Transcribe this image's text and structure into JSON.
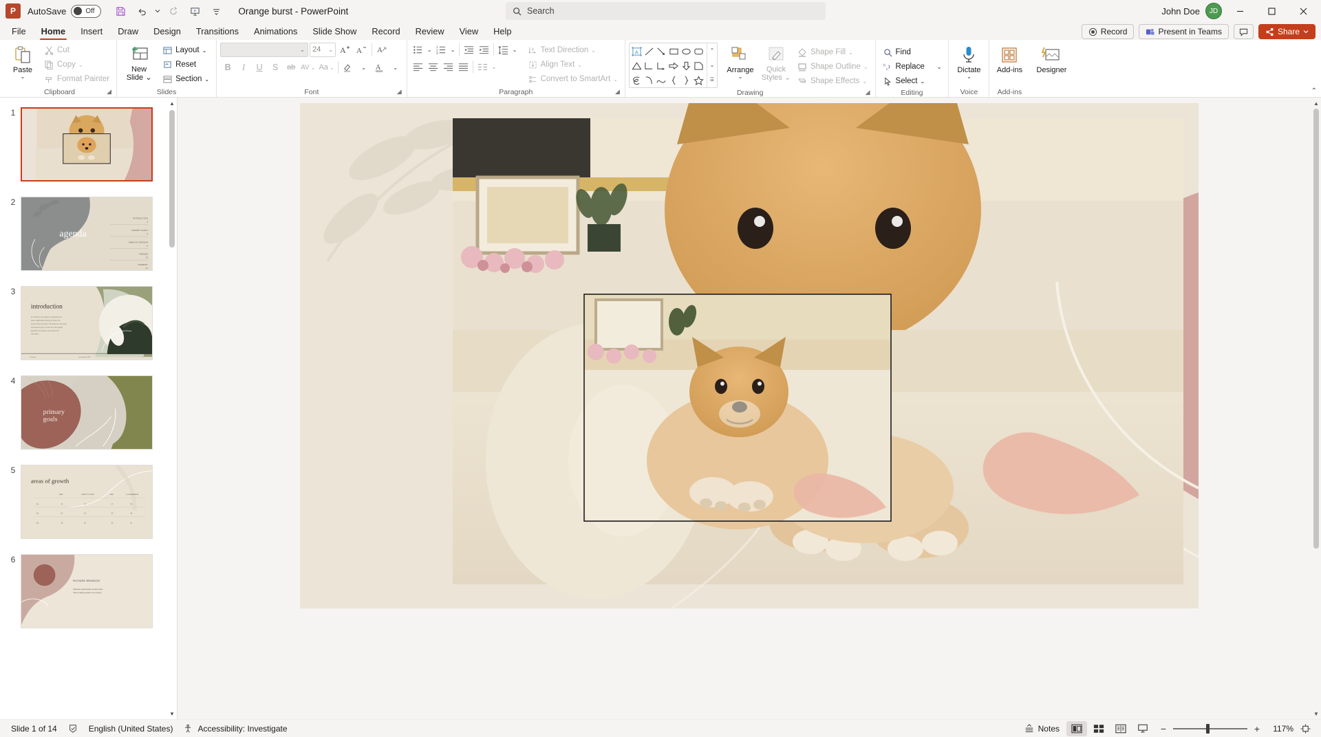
{
  "titlebar": {
    "logo": "P",
    "autosave_label": "AutoSave",
    "autosave_state": "Off",
    "quick_access": [
      {
        "name": "save-button",
        "glyph": "ὋE"
      },
      {
        "name": "undo-button",
        "glyph": "↶"
      },
      {
        "name": "redo-button",
        "glyph": "↻"
      },
      {
        "name": "start-presentation-button",
        "glyph": "⬜"
      },
      {
        "name": "customize-quick-access-button",
        "glyph": "⌵"
      }
    ],
    "document_title": "Orange burst  -  PowerPoint",
    "search_placeholder": "Search",
    "user_name": "John Doe",
    "avatar_initials": "JD",
    "window_buttons": [
      "minimize",
      "maximize",
      "close"
    ]
  },
  "tabs": [
    {
      "label": "File",
      "active": false
    },
    {
      "label": "Home",
      "active": true
    },
    {
      "label": "Insert",
      "active": false
    },
    {
      "label": "Draw",
      "active": false
    },
    {
      "label": "Design",
      "active": false
    },
    {
      "label": "Transitions",
      "active": false
    },
    {
      "label": "Animations",
      "active": false
    },
    {
      "label": "Slide Show",
      "active": false
    },
    {
      "label": "Record",
      "active": false
    },
    {
      "label": "Review",
      "active": false
    },
    {
      "label": "View",
      "active": false
    },
    {
      "label": "Help",
      "active": false
    }
  ],
  "tabs_right": {
    "record_label": "Record",
    "present_in_teams_label": "Present in Teams",
    "comments_label": "",
    "share_label": "Share"
  },
  "ribbon": {
    "clipboard": {
      "group_label": "Clipboard",
      "paste_label": "Paste",
      "cut_label": "Cut",
      "copy_label": "Copy",
      "format_painter_label": "Format Painter"
    },
    "slides": {
      "group_label": "Slides",
      "new_slide_label_line1": "New",
      "new_slide_label_line2": "Slide",
      "layout_label": "Layout",
      "reset_label": "Reset",
      "section_label": "Section"
    },
    "font": {
      "group_label": "Font",
      "font_name_value": "",
      "font_size_value": "24",
      "bold_label": "B",
      "italic_label": "I",
      "underline_label": "U",
      "shadow_label": "S",
      "strikethrough_label": "ab",
      "character_spacing_label": "AV",
      "change_case_label": "Aa",
      "increase_font_label": "A",
      "decrease_font_label": "A",
      "clear_formatting_label": "A"
    },
    "paragraph": {
      "group_label": "Paragraph",
      "text_direction_label": "Text Direction",
      "align_text_label": "Align Text",
      "convert_to_smartart_label": "Convert to SmartArt"
    },
    "drawing": {
      "group_label": "Drawing",
      "arrange_label": "Arrange",
      "quick_styles_line1": "Quick",
      "quick_styles_line2": "Styles",
      "shape_fill_label": "Shape Fill",
      "shape_outline_label": "Shape Outline",
      "shape_effects_label": "Shape Effects"
    },
    "editing": {
      "group_label": "Editing",
      "find_label": "Find",
      "replace_label": "Replace",
      "select_label": "Select"
    },
    "voice": {
      "group_label": "Voice",
      "dictate_label": "Dictate"
    },
    "addins": {
      "group_label": "Add-ins",
      "addins_label": "Add-ins"
    },
    "designer": {
      "designer_label": "Designer"
    }
  },
  "thumbnails": [
    {
      "number": "1",
      "selected": true,
      "kind": "photo-dog",
      "title": ""
    },
    {
      "number": "2",
      "selected": false,
      "kind": "agenda",
      "title": "agenda",
      "items": [
        {
          "label": "INTRODUCTION",
          "page": "3"
        },
        {
          "label": "PRIMARY GOALS",
          "page": "5"
        },
        {
          "label": "AREAS OF GROWTH",
          "page": "8"
        },
        {
          "label": "TIMELINE",
          "page": "10"
        },
        {
          "label": "SUMMARY",
          "page": "14"
        }
      ]
    },
    {
      "number": "3",
      "selected": false,
      "kind": "introduction",
      "title": "introduction",
      "body": "At Z Interiors we empower organizations to foster collaborative thinking to further the overall value proposition. By driving the next-level convergence gap, we have the micro-quality approach and create a memorable first impression."
    },
    {
      "number": "4",
      "selected": false,
      "kind": "primary-goals",
      "title": "primary goals",
      "title_line1": "primary",
      "title_line2": "goals"
    },
    {
      "number": "5",
      "selected": false,
      "kind": "areas-of-growth",
      "title": "areas of growth",
      "columns": [
        "",
        "B2B",
        "SUPPLY CHAIN",
        "R&D",
        "E-COMMERCE"
      ]
    },
    {
      "number": "6",
      "selected": false,
      "kind": "quote",
      "title": "RICHARD BRANDON",
      "quote": "\"Business opportunities are like buses. There's always another one coming.\""
    }
  ],
  "slide": {
    "number": "1",
    "selected_image_name": "doge-shiba-inu-photo",
    "has_selection_handles": true
  },
  "statusbar": {
    "slide_counter": "Slide 1 of 14",
    "language": "English (United States)",
    "accessibility": "Accessibility: Investigate",
    "notes_label": "Notes",
    "zoom_percent": "117%",
    "views": [
      "normal-view",
      "slide-sorter-view",
      "reading-view",
      "slide-show-view"
    ]
  },
  "colors": {
    "accent": "#c43e1c",
    "slide_bg": "#e9e2d7",
    "agenda_gray": "#8a8d8c",
    "goals_rose": "#9d6258",
    "goals_olive": "#81864f"
  }
}
